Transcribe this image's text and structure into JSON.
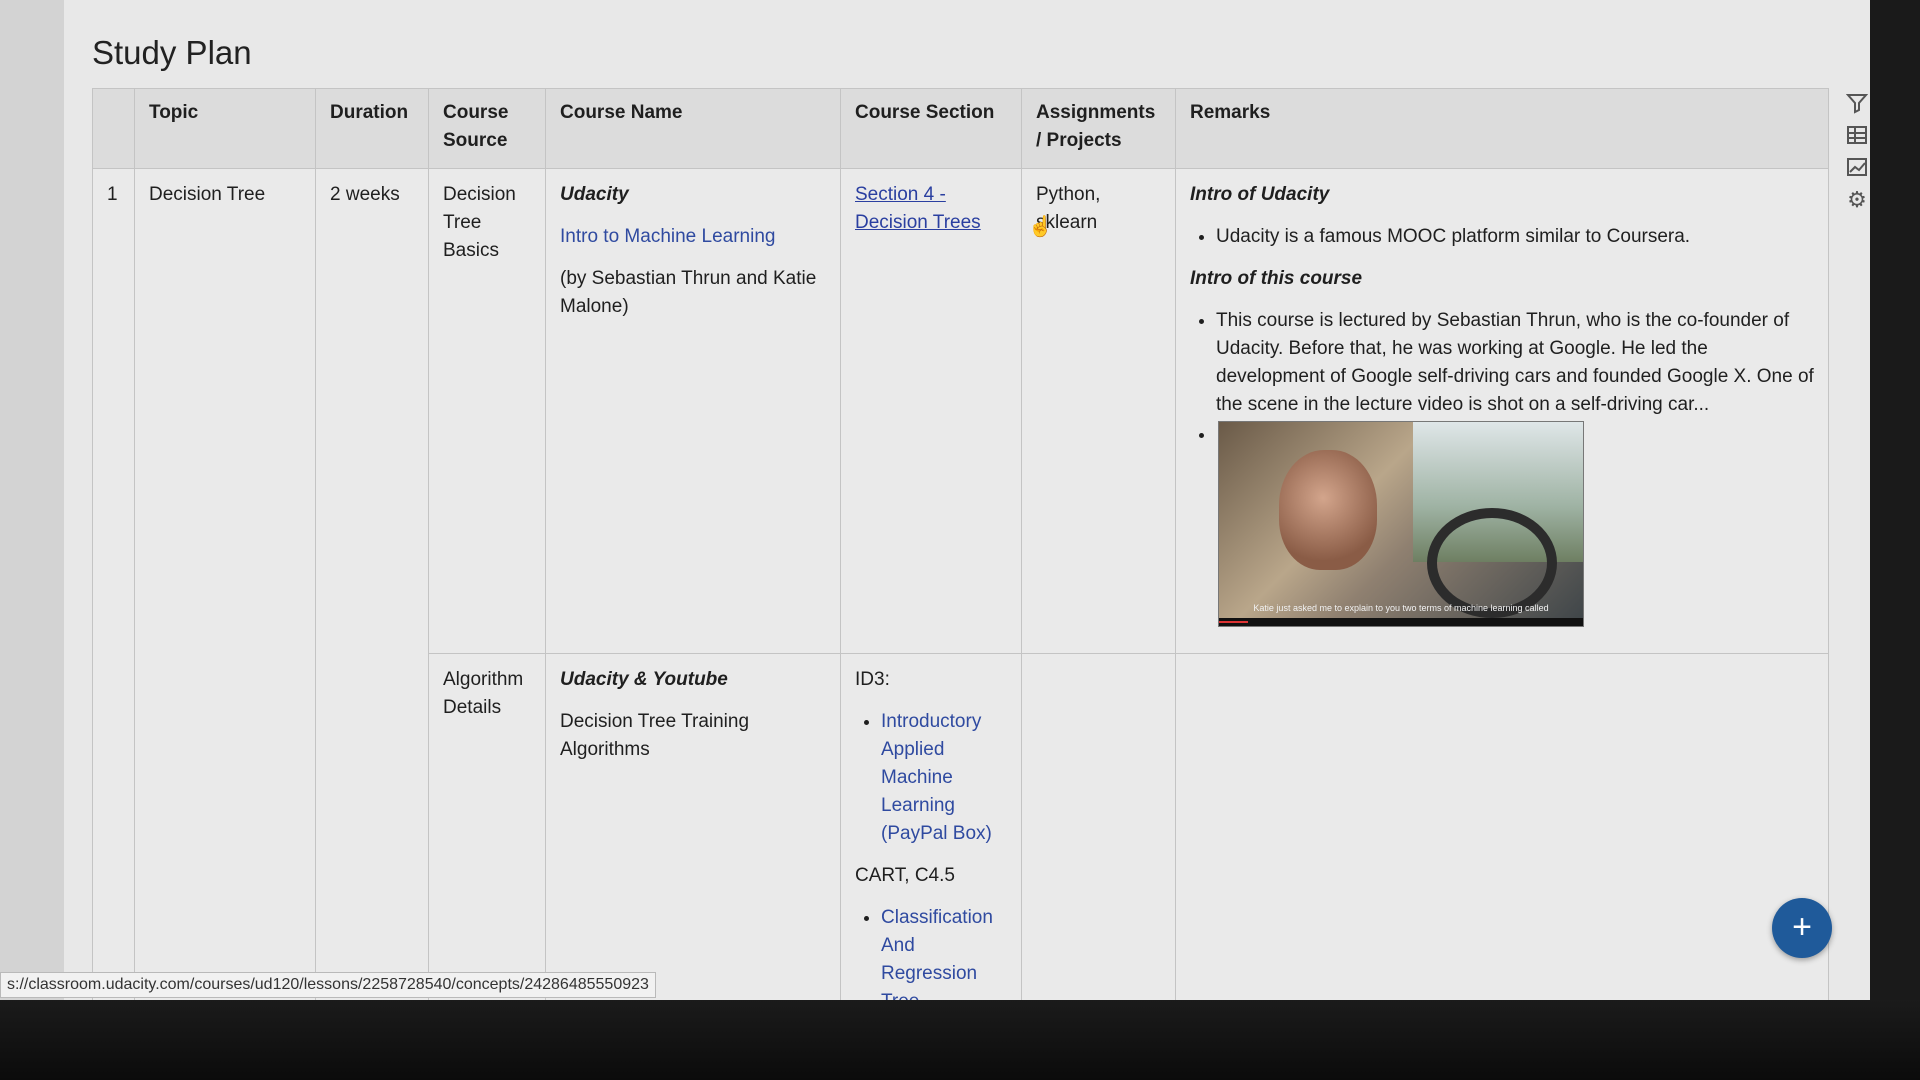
{
  "page": {
    "title": "Study Plan"
  },
  "table": {
    "headers": [
      "",
      "Topic",
      "Duration",
      "Course Source",
      "Course Name",
      "Course Section",
      "Assignments / Projects",
      "Remarks"
    ],
    "row1": {
      "num": "1",
      "topic": "Decision Tree",
      "duration": "2 weeks",
      "source": "Decision Tree Basics",
      "course_provider": "Udacity",
      "course_link": "Intro to Machine Learning",
      "course_authors": "(by Sebastian Thrun and Katie Malone)",
      "section_link": "Section 4 - Decision Trees",
      "assignments": "Python, sklearn",
      "remarks": {
        "heading1": "Intro of Udacity",
        "bullet1": "Udacity is a famous MOOC platform similar to Coursera.",
        "heading2": "Intro of this course",
        "bullet2": "This course is lectured by Sebastian Thrun, who is the co-founder of Udacity. Before that, he was working at Google. He led the development of Google self-driving cars and founded Google X. One of the scene in the lecture video is shot on a self-driving car...",
        "video_caption": "Katie just asked me to explain to you two terms of machine learning called",
        "video_progress": 0.08
      }
    },
    "row2": {
      "source": "Algorithm Details",
      "course_provider": "Udacity & Youtube",
      "course_name": "Decision Tree Training Algorithms",
      "section_label1": "ID3:",
      "section_link1": "Introductory Applied Machine Learning (PayPal Box)",
      "section_label2": "CART, C4.5",
      "section_link2": "Classification And Regression Tree"
    }
  },
  "toolbar": {
    "icons": [
      "filter-icon",
      "table-icon",
      "chart-icon",
      "gear-icon"
    ]
  },
  "fab": {
    "label": "+"
  },
  "status_bar": {
    "url": "s://classroom.udacity.com/courses/ud120/lessons/2258728540/concepts/24286485550923"
  }
}
